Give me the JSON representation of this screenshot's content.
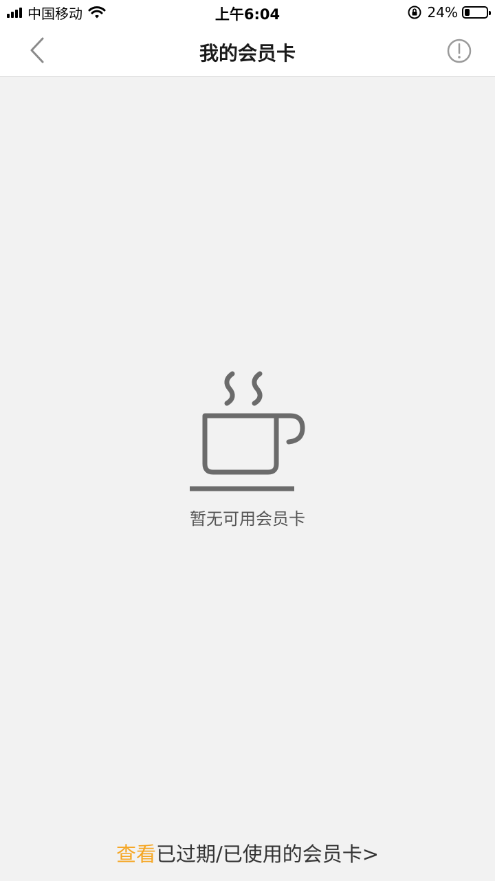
{
  "status_bar": {
    "carrier": "中国移动",
    "time": "上午6:04",
    "battery_percent": "24%",
    "battery_level": 0.24,
    "icons": [
      "signal-icon",
      "wifi-icon",
      "rotation-lock-icon",
      "battery-icon"
    ]
  },
  "nav": {
    "title": "我的会员卡",
    "back_icon": "chevron-left-icon",
    "info_icon": "exclamation-circle-icon"
  },
  "empty_state": {
    "icon": "coffee-cup-icon",
    "message": "暂无可用会员卡"
  },
  "footer": {
    "link_highlight": "查看",
    "link_rest": "已过期/已使用的会员卡>"
  },
  "colors": {
    "accent": "#f5a623",
    "background": "#f2f2f2",
    "icon_gray": "#6b6b6b"
  }
}
